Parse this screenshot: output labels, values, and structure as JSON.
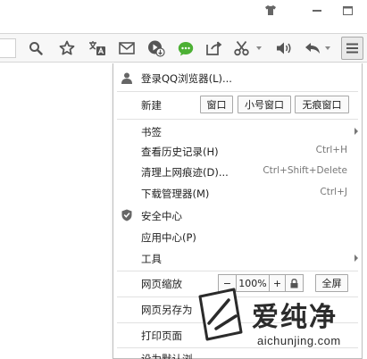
{
  "titlebar": {
    "icons": [
      "skin-icon",
      "minimize-icon",
      "maximize-icon"
    ]
  },
  "toolbar": {
    "icons": [
      "search-icon",
      "favorite-star-icon",
      "translate-icon",
      "mail-icon",
      "video-download-icon",
      "wechat-icon",
      "share-icon",
      "screenshot-scissors-icon",
      "volume-icon",
      "undo-close-icon",
      "main-menu-icon"
    ],
    "accent_green": "#4cb034"
  },
  "menu": {
    "login": "登录QQ浏览器(L)...",
    "new_label": "新建",
    "new_window": "窗口",
    "new_small_window": "小号窗口",
    "new_private_window": "无痕窗口",
    "bookmarks": "书签",
    "history": "查看历史记录(H)",
    "history_shortcut": "Ctrl+H",
    "clear_traces": "清理上网痕迹(D)...",
    "clear_shortcut": "Ctrl+Shift+Delete",
    "downloads": "下载管理器(M)",
    "downloads_shortcut": "Ctrl+J",
    "security": "安全中心",
    "app_center": "应用中心(P)",
    "tools": "工具",
    "zoom_label": "网页缩放",
    "zoom_minus": "−",
    "zoom_value": "100%",
    "zoom_plus": "+",
    "fullscreen": "全屏",
    "save_as": "网页另存为",
    "print": "打印页面",
    "next_partial": "设为默认浏"
  },
  "watermark": {
    "chinese": "爱纯净",
    "url": "aichunjing.com"
  }
}
